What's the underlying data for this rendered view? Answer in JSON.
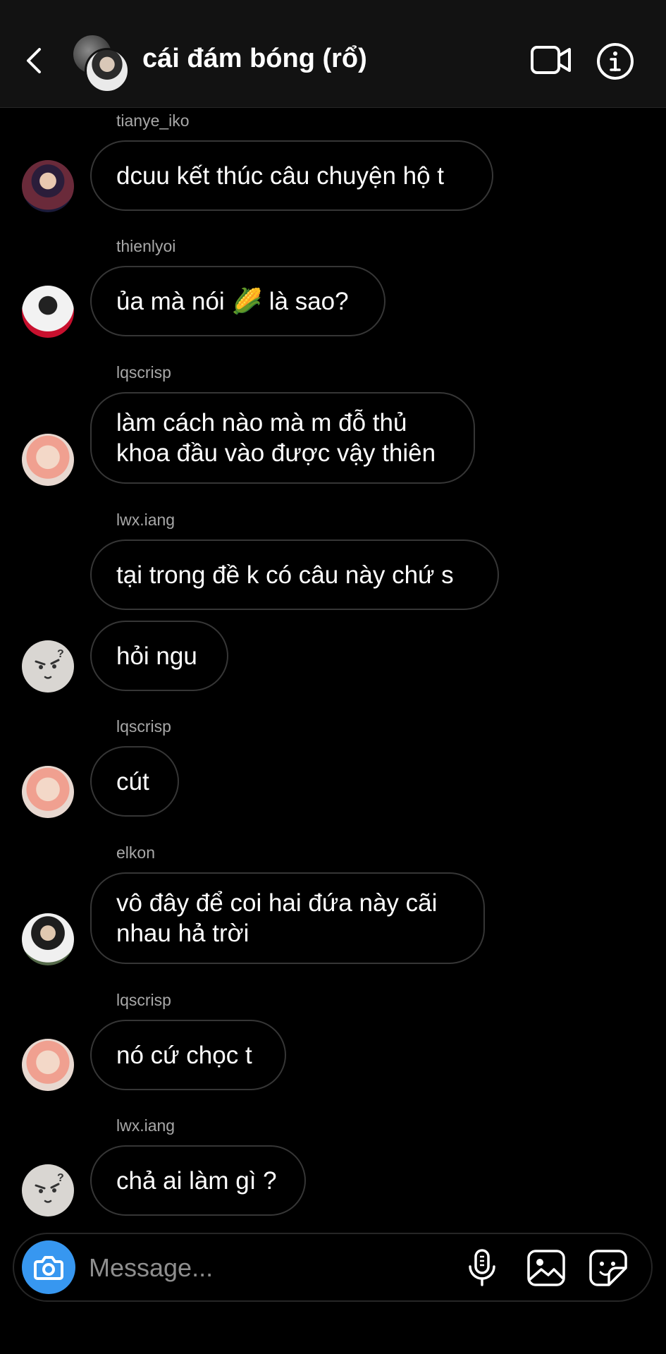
{
  "header": {
    "title": "cái đám bóng (rổ)",
    "icons": [
      "back-chevron-icon",
      "group-avatar",
      "video-call-icon",
      "info-icon"
    ]
  },
  "messages": [
    {
      "sender": "tianye_iko",
      "text_lines": [
        "dcuu kết thúc câu chuyện hộ t"
      ],
      "avatar": "tianye"
    },
    {
      "sender": "thienlyoi",
      "text_before": "ủa mà nói ",
      "emoji": "🌽",
      "text_after": " là sao?",
      "avatar": "thien"
    },
    {
      "sender": "lqscrisp",
      "text_lines": [
        "làm cách nào mà m đỗ thủ",
        "khoa đầu vào được vậy thiên"
      ],
      "avatar": "lqs"
    },
    {
      "sender": "lwx.iang",
      "text_lines": [
        "tại trong đề k có câu này chứ s"
      ],
      "avatar": null
    },
    {
      "sender": null,
      "text_lines": [
        "hỏi ngu"
      ],
      "avatar": "lwx"
    },
    {
      "sender": "lqscrisp",
      "text_lines": [
        "cút"
      ],
      "avatar": "lqs"
    },
    {
      "sender": "elkon",
      "text_lines": [
        "vô đây để coi hai đứa này cãi",
        "nhau hả trời"
      ],
      "avatar": "elkon"
    },
    {
      "sender": "lqscrisp",
      "text_lines": [
        "nó cứ chọc t"
      ],
      "avatar": "lqs"
    },
    {
      "sender": "lwx.iang",
      "text_lines": [
        "chả ai làm gì ?"
      ],
      "avatar": "lwx"
    }
  ],
  "composer": {
    "placeholder": "Message...",
    "icons": [
      "camera-icon",
      "microphone-icon",
      "gallery-icon",
      "sticker-icon"
    ]
  },
  "colors": {
    "background": "#000000",
    "header_bg": "#121212",
    "bubble_border": "#363636",
    "sender_text": "#a8a8a8",
    "camera_button": "#3797f0"
  }
}
